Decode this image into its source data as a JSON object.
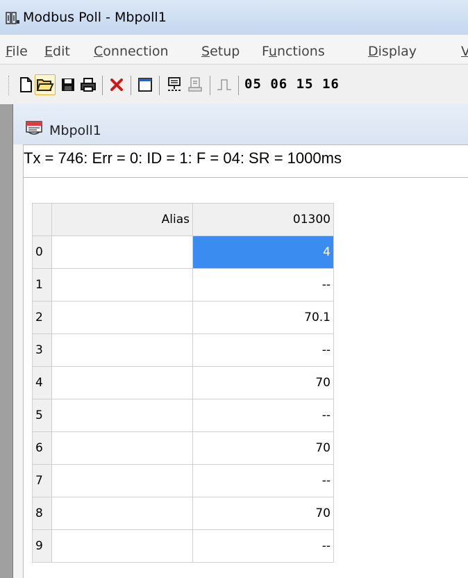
{
  "window": {
    "title": "Modbus Poll - Mbpoll1",
    "icon": "modbus-app-icon"
  },
  "menu": [
    {
      "label": "File",
      "mnemonic": "F",
      "rest": "ile"
    },
    {
      "label": "Edit",
      "mnemonic": "E",
      "rest": "dit"
    },
    {
      "label": "Connection",
      "mnemonic": "C",
      "rest": "onnection"
    },
    {
      "label": "Setup",
      "mnemonic": "S",
      "rest": "etup"
    },
    {
      "label": "Functions",
      "pre": "F",
      "mnemonic": "u",
      "rest": "nctions"
    },
    {
      "label": "Display",
      "mnemonic": "D",
      "rest": "isplay"
    },
    {
      "label": "View",
      "mnemonic": "V",
      "rest": ""
    }
  ],
  "toolbar": {
    "buttons": [
      "new-icon",
      "open-icon",
      "save-icon",
      "print-icon",
      "close-icon",
      "window-icon",
      "connect-icon",
      "disconnect-icon",
      "pulse-icon"
    ],
    "function_codes": "05 06 15 16"
  },
  "child": {
    "title": "Mbpoll1",
    "icon": "document-icon",
    "status": "Tx = 746: Err = 0: ID = 1: F = 04: SR = 1000ms",
    "grid": {
      "headers": {
        "alias": "Alias",
        "address": "01300"
      },
      "rows": [
        {
          "index": "0",
          "alias": "",
          "value": "4",
          "selected": true
        },
        {
          "index": "1",
          "alias": "",
          "value": "--"
        },
        {
          "index": "2",
          "alias": "",
          "value": "70.1"
        },
        {
          "index": "3",
          "alias": "",
          "value": "--"
        },
        {
          "index": "4",
          "alias": "",
          "value": "70"
        },
        {
          "index": "5",
          "alias": "",
          "value": "--"
        },
        {
          "index": "6",
          "alias": "",
          "value": "70"
        },
        {
          "index": "7",
          "alias": "",
          "value": "--"
        },
        {
          "index": "8",
          "alias": "",
          "value": "70"
        },
        {
          "index": "9",
          "alias": "",
          "value": "--"
        }
      ]
    }
  },
  "colors": {
    "selection": "#3b8cf0"
  }
}
